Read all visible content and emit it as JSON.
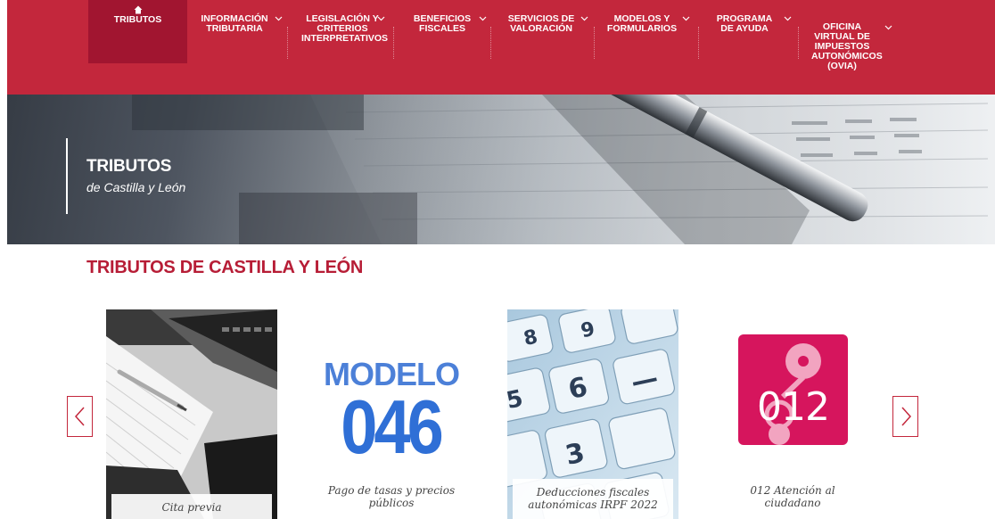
{
  "nav": {
    "items": [
      {
        "label": "Tributos"
      },
      {
        "label": "Información tributaria"
      },
      {
        "label": "Legislación y criterios interpretativos"
      },
      {
        "label": "Beneficios fiscales"
      },
      {
        "label": "Servicios de valoración"
      },
      {
        "label": "Modelos y formularios"
      },
      {
        "label": "Programa de ayuda"
      },
      {
        "label": "Oficina virtual de impuestos autonómicos (OVIA)"
      }
    ],
    "active_index": 0,
    "colors": {
      "bar": "#c3273c",
      "active": "#a11530"
    }
  },
  "hero": {
    "title": "TRIBUTOS",
    "subtitle": "de Castilla y León"
  },
  "section": {
    "title": "TRIBUTOS DE CASTILLA Y LEÓN",
    "color": "#b71d36"
  },
  "carousel": {
    "cards": [
      {
        "caption": "Cita previa",
        "image": "laptop-notebook-photo"
      },
      {
        "caption": "Pago de tasas y precios públicos",
        "image": "modelo-046-logo",
        "logo_top": "MODELO",
        "logo_bottom": "046"
      },
      {
        "caption": "Deducciones fiscales autonómicas IRPF 2022",
        "image": "calculator-keys-photo"
      },
      {
        "caption": "012 Atención al ciudadano",
        "image": "012-logo",
        "logo_text": "012"
      }
    ],
    "prev_icon": "chevron-left-icon",
    "next_icon": "chevron-right-icon"
  }
}
